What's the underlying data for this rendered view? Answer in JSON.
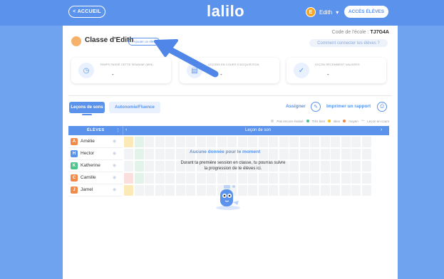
{
  "topbar": {
    "back_label": "< ACCUEIL",
    "logo_text": "lalilo",
    "user_name": "Edith",
    "user_initial": "E",
    "user_menu_caret": "▾",
    "student_access_label": "ACCÈS ÉLÈVES"
  },
  "class": {
    "title": "Classe d'Edith",
    "add_student_label": "+ Ajouter un élève",
    "school_code_label": "Code de l'école : ",
    "school_code_value": "TJ7G4A",
    "connect_link": "Comment connecter tes élèves ?"
  },
  "stats": [
    {
      "label": "TEMPS PASSÉ CETTE SEMAINE (MIN)",
      "value": "-",
      "icon": "clock-icon"
    },
    {
      "label": "LEÇONS EN COURS D'ACQUISITION",
      "value": "-",
      "icon": "book-icon"
    },
    {
      "label": "LEÇON RÉCEMMENT VALIDÉES",
      "value": "-",
      "icon": "clipboard-check-icon"
    }
  ],
  "tabs": [
    {
      "label": "Leçons de sons",
      "active": true
    },
    {
      "label": "Autonomie/Fluence",
      "active": false
    }
  ],
  "actions": {
    "assign_label": "Assigner",
    "print_label": "Imprimer un rapport"
  },
  "legend": [
    {
      "label": "Pas encore évalué",
      "color": "#d8d8d8"
    },
    {
      "label": "Très bien",
      "color": "#4cc38a"
    },
    {
      "label": "Bien",
      "color": "#f5c518"
    },
    {
      "label": "moyen",
      "color": "#f08a4b"
    },
    {
      "label": "Leçon en cours",
      "color": "#c5cdd8"
    }
  ],
  "grid": {
    "students_header": "ÉLÈVES",
    "lesson_header": "Leçon de son",
    "prev_icon": "chevron-left-icon",
    "next_icon": "chevron-right-icon",
    "students": [
      {
        "name": "Amélie",
        "initial": "A",
        "color": "#f08a4b"
      },
      {
        "name": "Hector",
        "initial": "H",
        "color": "#5b93ec"
      },
      {
        "name": "Katherine",
        "initial": "K",
        "color": "#4cc38a"
      },
      {
        "name": "Camille",
        "initial": "C",
        "color": "#f08a4b"
      },
      {
        "name": "Jamel",
        "initial": "J",
        "color": "#f08a4b"
      }
    ],
    "empty_title": "Aucune donnée pour le moment",
    "empty_text": "Durant ta première session en classe, tu pourras suivre la progression de te élèves ici."
  },
  "colors": {
    "accent": "#5b93ec",
    "background": "#6fa3f0"
  }
}
